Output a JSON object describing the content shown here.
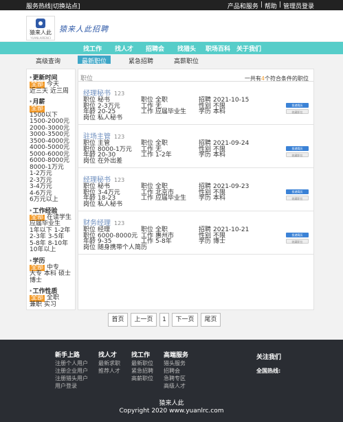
{
  "topbar": {
    "left": "服务热线|切换站点]",
    "links": [
      "产品和服务",
      "|",
      "帮助",
      "|",
      "管理员登录"
    ]
  },
  "header": {
    "logo_text": "猿来人此",
    "logo_sub": "YUANLAIRENCI",
    "slogan": "猿来人此招聘",
    "logo_color": "#2f5aa8"
  },
  "nav": {
    "color": "#56cdc9",
    "items": [
      "找工作",
      "找人才",
      "招聘会",
      "找猎头",
      "职场百科",
      "关于我们"
    ]
  },
  "subnav": {
    "items": [
      "高级查询",
      "最新职位",
      "紧急招聘",
      "高薪职位"
    ],
    "active_index": 1,
    "active_color": "#3ea6c7"
  },
  "sidebar": {
    "sections": [
      {
        "title": "更新时间",
        "options": [
          "全部",
          "今天",
          "近三天",
          "近三周"
        ],
        "selected": 0
      },
      {
        "title": "月薪",
        "options": [
          "全部",
          "1500以下",
          "1500-2000元",
          "2000-3000元",
          "3000-3500元",
          "3500-4000元",
          "4000-5000元",
          "5000-6000元",
          "6000-8000元",
          "8000-1万元",
          "1-2万元",
          "2-3万元",
          "3-4万元",
          "4-6万元",
          "6万元以上"
        ],
        "selected": 0
      },
      {
        "title": "工作经验",
        "options": [
          "全部",
          "在读学生",
          "应届毕业生",
          "1年以下",
          "1-2年",
          "2-3年",
          "3-5年",
          "5-8年",
          "8-10年",
          "10年以上"
        ],
        "selected": 0
      },
      {
        "title": "学历",
        "options": [
          "全部",
          "中专",
          "大专",
          "本科",
          "硕士",
          "博士"
        ],
        "selected": 0
      },
      {
        "title": "工作性质",
        "options": [
          "全部",
          "全职",
          "兼职",
          "实习"
        ],
        "selected": 0
      }
    ],
    "selected_color": "#f39b2b"
  },
  "main": {
    "list_label": "职位",
    "count_prefix": "一共有",
    "count": "4",
    "count_suffix": "个符合条件的职位",
    "apply_label": "投递简历",
    "fav_label": "收藏职位",
    "jobs": [
      {
        "title": "经理秘书",
        "num": "123",
        "c1": [
          [
            "职位",
            "秘书"
          ],
          [
            "职位",
            "2-3万元"
          ],
          [
            "年龄",
            "20-25"
          ],
          [
            "岗位",
            "私人秘书"
          ]
        ],
        "c2": [
          [
            "职位",
            "全职"
          ],
          [
            "工作",
            "无"
          ],
          [
            "工作",
            "应届毕业生"
          ]
        ],
        "c3": [
          [
            "招聘",
            "2021-10-15"
          ],
          [
            "性别",
            "不限"
          ],
          [
            "学历",
            "本科"
          ]
        ]
      },
      {
        "title": "驻场主管",
        "num": "123",
        "c1": [
          [
            "职位",
            "主管"
          ],
          [
            "职位",
            "8000-1万元"
          ],
          [
            "年龄",
            "20-30"
          ],
          [
            "岗位",
            "在外出差"
          ]
        ],
        "c2": [
          [
            "职位",
            "全职"
          ],
          [
            "工作",
            "无"
          ],
          [
            "工作",
            "1-2年"
          ]
        ],
        "c3": [
          [
            "招聘",
            "2021-09-24"
          ],
          [
            "性别",
            "不限"
          ],
          [
            "学历",
            "本科"
          ]
        ]
      },
      {
        "title": "经理秘书",
        "num": "123",
        "c1": [
          [
            "职位",
            "秘书"
          ],
          [
            "职位",
            "3-4万元"
          ],
          [
            "年龄",
            "18-23"
          ],
          [
            "岗位",
            "私人秘书"
          ]
        ],
        "c2": [
          [
            "职位",
            "全职"
          ],
          [
            "工作",
            "北京市"
          ],
          [
            "工作",
            "应届毕业生"
          ]
        ],
        "c3": [
          [
            "招聘",
            "2021-09-23"
          ],
          [
            "性别",
            "不限"
          ],
          [
            "学历",
            "本科"
          ]
        ]
      },
      {
        "title": "财务经理",
        "num": "123",
        "c1": [
          [
            "职位",
            "经理"
          ],
          [
            "职位",
            "6000-8000元"
          ],
          [
            "年龄",
            "9-35"
          ],
          [
            "岗位",
            "随身携带个人简历"
          ]
        ],
        "c2": [
          [
            "职位",
            "全职"
          ],
          [
            "工作",
            "惠州市"
          ],
          [
            "工作",
            "5-8年"
          ]
        ],
        "c3": [
          [
            "招聘",
            "2021-10-21"
          ],
          [
            "性别",
            "不限"
          ],
          [
            "学历",
            "博士"
          ]
        ]
      }
    ]
  },
  "pager": {
    "items": [
      "首页",
      "上一页",
      "1",
      "下一页",
      "尾页"
    ]
  },
  "footer": {
    "columns": [
      {
        "title": "新手上路",
        "links": [
          "注册个人用户",
          "注册企业用户",
          "注册猎头用户",
          "用户登录"
        ]
      },
      {
        "title": "找人才",
        "links": [
          "最新求职",
          "推荐人才"
        ]
      },
      {
        "title": "找工作",
        "links": [
          "最新职位",
          "紧急招聘",
          "高薪职位"
        ]
      },
      {
        "title": "高端服务",
        "links": [
          "猎头服务",
          "招聘会",
          "急聘专区",
          "高级人才"
        ]
      }
    ],
    "contact_title": "关注我们",
    "contact_phone": "全国热线:",
    "site_name": "猿来人此",
    "copyright": "Copyright 2020 www.yuanlrc.com"
  }
}
